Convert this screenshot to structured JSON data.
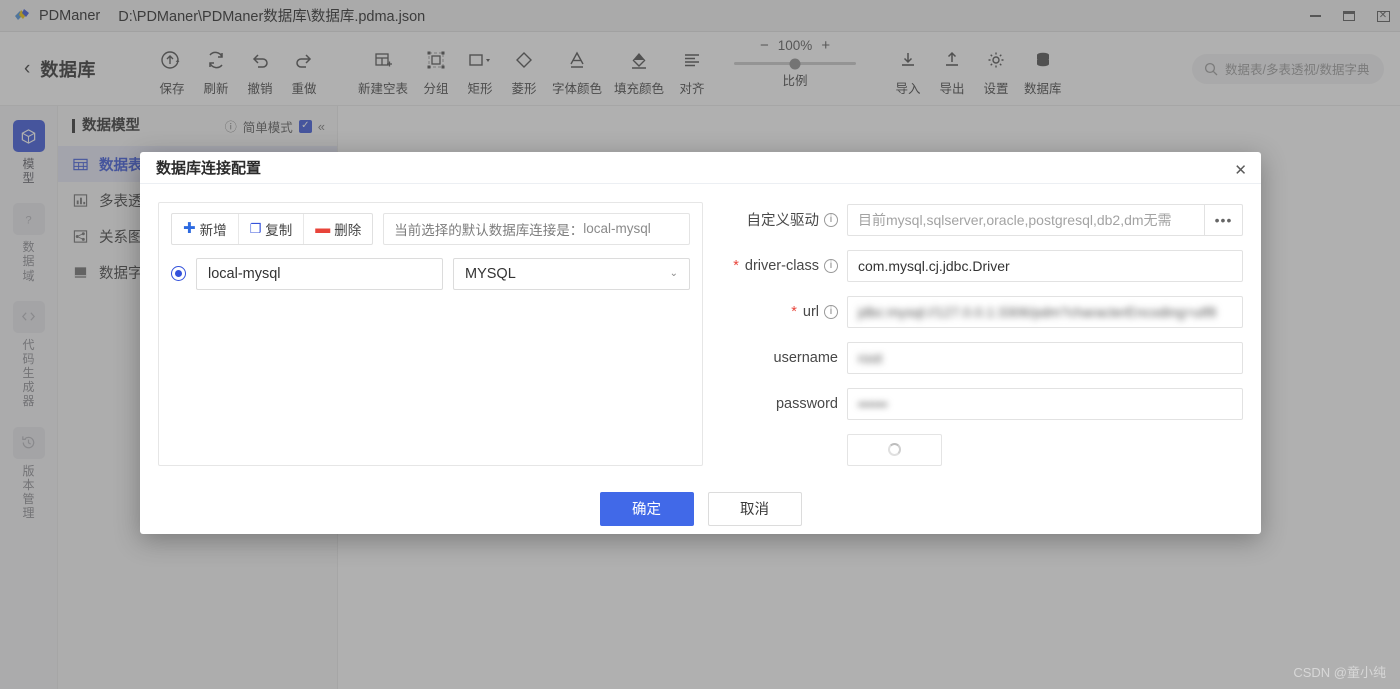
{
  "window": {
    "app_name": "PDManer",
    "file_path": "D:\\PDManer\\PDManer数据库\\数据库.pdma.json",
    "minimize_label": "—",
    "maximize_label": "□",
    "close_label": "✕"
  },
  "header": {
    "back_label": "数据库",
    "back_icon": "chevron-left-icon",
    "tools": [
      {
        "label": "保存",
        "icon": "save-cloud-icon",
        "has_caret": true
      },
      {
        "label": "刷新",
        "icon": "refresh-icon",
        "has_caret": false
      },
      {
        "label": "撤销",
        "icon": "undo-icon",
        "has_caret": false
      },
      {
        "label": "重做",
        "icon": "redo-icon",
        "has_caret": false
      },
      {
        "label": "新建空表",
        "icon": "new-table-icon",
        "has_caret": false
      },
      {
        "label": "分组",
        "icon": "group-icon",
        "has_caret": false
      },
      {
        "label": "矩形",
        "icon": "rectangle-icon",
        "has_caret": true
      },
      {
        "label": "菱形",
        "icon": "diamond-icon",
        "has_caret": false
      },
      {
        "label": "字体颜色",
        "icon": "font-color-icon",
        "has_caret": false
      },
      {
        "label": "填充颜色",
        "icon": "fill-color-icon",
        "has_caret": false
      },
      {
        "label": "对齐",
        "icon": "align-icon",
        "has_caret": false
      }
    ],
    "zoom": {
      "minus": "−",
      "value": "100%",
      "plus": "+",
      "label": "比例",
      "slider_percent": 50
    },
    "right_tools": [
      {
        "label": "导入",
        "icon": "import-icon"
      },
      {
        "label": "导出",
        "icon": "export-icon"
      },
      {
        "label": "设置",
        "icon": "gear-icon"
      },
      {
        "label": "数据库",
        "icon": "database-icon"
      }
    ],
    "search": {
      "placeholder": "数据表/多表透视/数据字典",
      "icon": "search-icon"
    }
  },
  "rail": {
    "items": [
      {
        "label": "模型",
        "icon": "cube-icon",
        "active": true
      },
      {
        "label": "数据域",
        "icon": "question-icon",
        "active": false
      },
      {
        "label": "代码生成器",
        "icon": "code-icon",
        "active": false
      },
      {
        "label": "版本管理",
        "icon": "history-icon",
        "active": false
      }
    ]
  },
  "tree": {
    "title": "数据模型",
    "mode_label": "简单模式",
    "mode_checked": true,
    "collapse_icon": "chevron-double-left-icon",
    "items": [
      {
        "label": "数据表",
        "icon": "table-icon",
        "selected": true
      },
      {
        "label": "多表透视",
        "icon": "chart-icon",
        "selected": false
      },
      {
        "label": "关系图",
        "icon": "relation-icon",
        "selected": false
      },
      {
        "label": "数据字典",
        "icon": "book-icon",
        "selected": false
      }
    ]
  },
  "dialog": {
    "title": "数据库连接配置",
    "close_label": "✕",
    "actions": [
      {
        "label": "新增",
        "icon": "plus-icon"
      },
      {
        "label": "复制",
        "icon": "copy-icon"
      },
      {
        "label": "删除",
        "icon": "minus-icon"
      }
    ],
    "default_note_prefix": "当前选择的默认数据库连接是：",
    "default_note_value": "local-mysql",
    "connection": {
      "name": "local-mysql",
      "selected": true,
      "db_type": "MYSQL",
      "db_type_caret": "⌄"
    },
    "form": {
      "custom_driver": {
        "label": "自定义驱动",
        "required": false,
        "has_info": true,
        "placeholder": "目前mysql,sqlserver,oracle,postgresql,db2,dm无需",
        "value": "",
        "dots_label": "•••"
      },
      "driver_class": {
        "label": "driver-class",
        "required": true,
        "has_info": true,
        "value": "com.mysql.cj.jdbc.Driver"
      },
      "url": {
        "label": "url",
        "required": true,
        "has_info": true,
        "value": "jdbc:mysql://127.0.0.1:3306/pdm?characterEncoding=utf8",
        "redacted": true
      },
      "username": {
        "label": "username",
        "required": false,
        "has_info": false,
        "value": "root",
        "redacted": true
      },
      "password": {
        "label": "password",
        "required": false,
        "has_info": false,
        "value": "••••••",
        "redacted": true
      },
      "test_button": {
        "label": "",
        "state": "loading",
        "icon": "spinner-icon"
      }
    },
    "footer": {
      "confirm_label": "确定",
      "cancel_label": "取消"
    }
  },
  "watermark": "CSDN @童小纯",
  "colors": {
    "accent": "#3452db",
    "primary_button": "#4169e8",
    "danger": "#e8443a",
    "titlebar": "#f3f3f3"
  }
}
